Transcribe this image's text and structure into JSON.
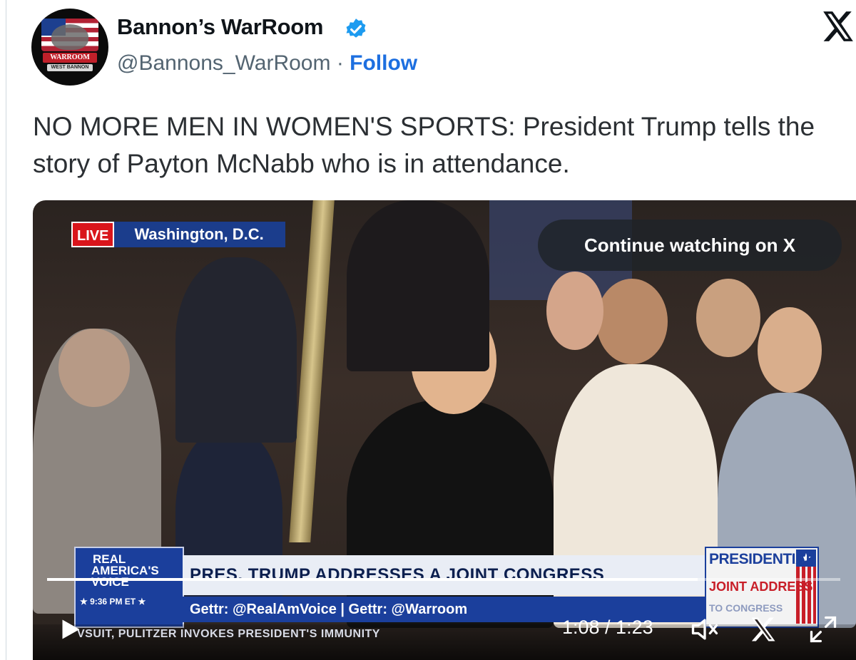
{
  "author": {
    "name": "Bannon’s WarRoom",
    "handle": "@Bannons_WarRoom",
    "separator": " · ",
    "follow_label": "Follow",
    "avatar_text": "WARROOM",
    "avatar_subtext": "WEST BANNON"
  },
  "tweet": {
    "text": "NO MORE MEN IN WOMEN'S SPORTS: President Trump tells the story of Payton McNabb who is in attendance."
  },
  "video": {
    "live_label": "LIVE",
    "location": "Washington, D.C.",
    "continue_label": "Continue watching on X",
    "network": {
      "line1": "REAL",
      "line2": "AMERICA'S",
      "line3": "VOICE",
      "time": "★ 9:36 PM ET ★"
    },
    "headline": "PRES. TRUMP ADDRESSES A JOINT CONGRESS",
    "ticker": "Gettr: @RealAmVoice  |  Gettr: @Warroom",
    "event": {
      "title": "PRESIDENTIAL",
      "subtitle": "JOINT ADDRESS",
      "tail": "TO CONGRESS"
    },
    "crawl": "VSUIT, PULITZER INVOKES PRESIDENT'S IMMUNITY",
    "elapsed": "1:08",
    "duration": "1:23",
    "time_display": "1:08 / 1:23",
    "progress": 0.82
  },
  "colors": {
    "follow": "#1d6fe0",
    "verified": "#1d9bf0",
    "live": "#d9151b",
    "network_blue": "#1b3f9c"
  },
  "icons": [
    "verified-badge-icon",
    "x-logo-icon",
    "play-icon",
    "mute-icon",
    "x-logo-small-icon",
    "fullscreen-icon"
  ]
}
